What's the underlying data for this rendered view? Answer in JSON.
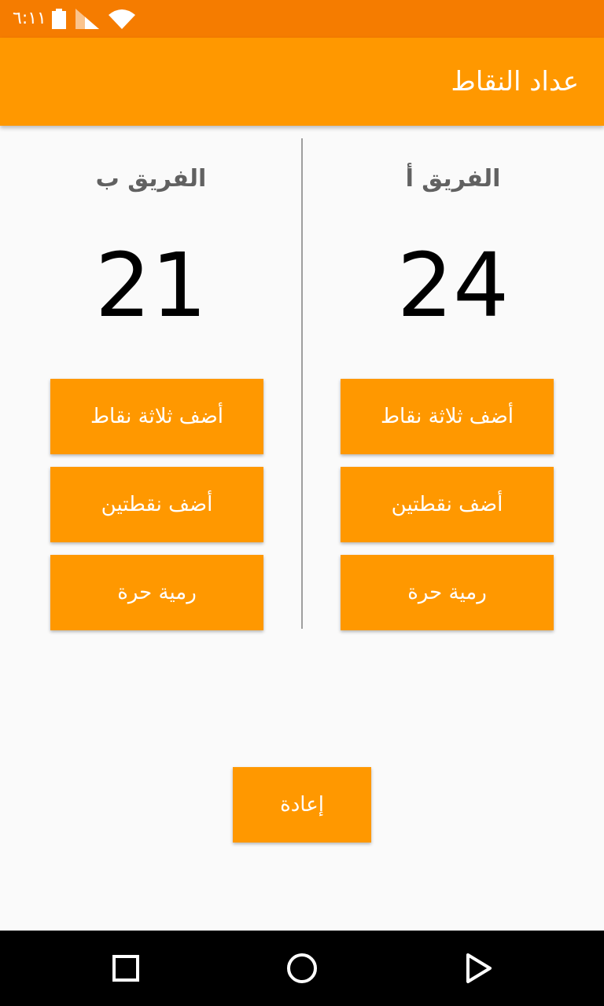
{
  "status_bar": {
    "time": "٦:١١",
    "icons": [
      "battery-icon",
      "signal-icon",
      "wifi-icon"
    ]
  },
  "app_bar": {
    "title": "عداد النقاط"
  },
  "team_a": {
    "name": "الفريق أ",
    "score": "24",
    "buttons": {
      "three": "أضف ثلاثة نقاط",
      "two": "أضف نقطتين",
      "free_throw": "رمية حرة"
    }
  },
  "team_b": {
    "name": "الفريق ب",
    "score": "21",
    "buttons": {
      "three": "أضف ثلاثة نقاط",
      "two": "أضف نقطتين",
      "free_throw": "رمية حرة"
    }
  },
  "reset": {
    "label": "إعادة"
  },
  "nav": [
    "recents-icon",
    "home-icon",
    "back-icon"
  ],
  "colors": {
    "status_bar": "#f57c00",
    "accent": "#ff9800",
    "team_name": "#616161",
    "background": "#fafafa"
  }
}
